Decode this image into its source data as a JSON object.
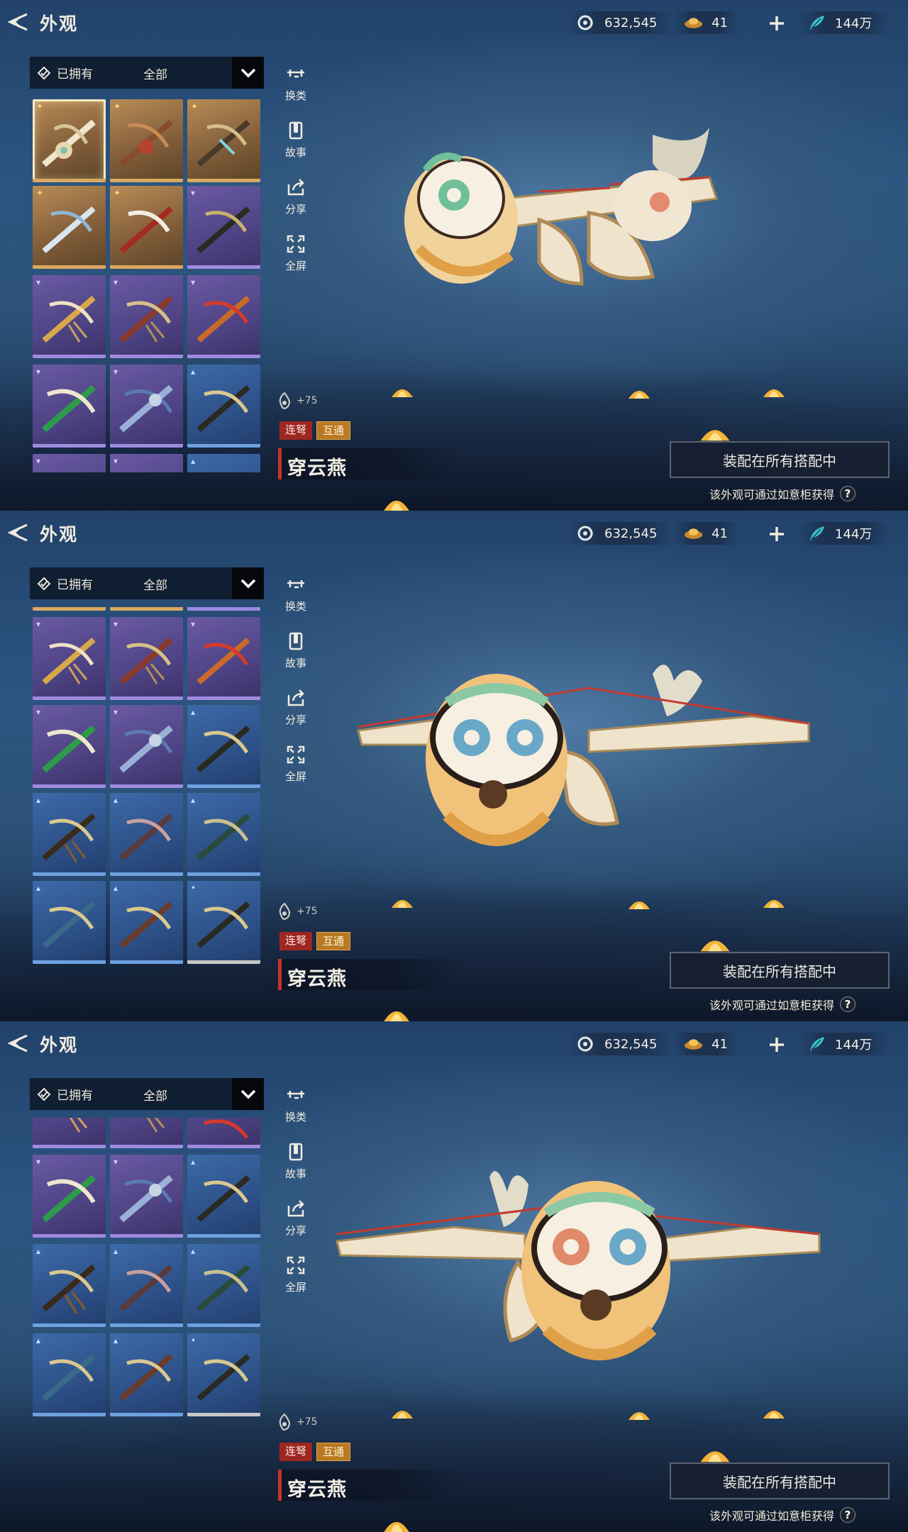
{
  "header": {
    "title": "外观"
  },
  "currency": [
    {
      "icon": "jade-coin-icon",
      "value": "632,545"
    },
    {
      "icon": "gold-ingot-icon",
      "value": "41"
    },
    {
      "icon": "feather-token-icon",
      "value": "144万"
    }
  ],
  "filter": {
    "owned_label": "已拥有",
    "category_label": "全部"
  },
  "actions": [
    {
      "icon": "crossbow-swap-icon",
      "label": "换类"
    },
    {
      "icon": "book-icon",
      "label": "故事"
    },
    {
      "icon": "share-icon",
      "label": "分享"
    },
    {
      "icon": "fullscreen-icon",
      "label": "全屏"
    }
  ],
  "item": {
    "power": "+75",
    "tags": [
      "连弩",
      "互通"
    ],
    "name": "穿云燕",
    "equip_label": "装配在所有搭配中",
    "hint": "该外观可通过如意柜获得",
    "help": "?"
  },
  "colors": {
    "gold": "#d9a861",
    "purple": "#9f8ae0",
    "blue": "#6da1e0",
    "tag_red": "#9e2722",
    "tag_gold": "#b97a23"
  }
}
